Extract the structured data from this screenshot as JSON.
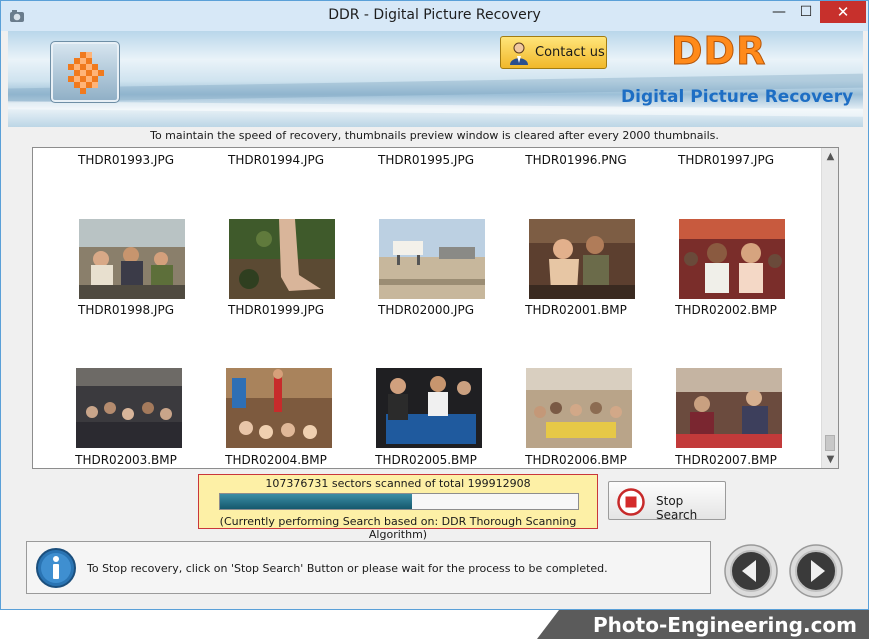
{
  "window": {
    "title": "DDR - Digital Picture Recovery",
    "min_glyph": "—",
    "max_glyph": "☐",
    "close_glyph": "✕"
  },
  "header": {
    "contact_label": "Contact us",
    "brand": "DDR",
    "subtitle": "Digital Picture Recovery"
  },
  "notice": "To maintain the speed of recovery, thumbnails preview window is cleared after every 2000 thumbnails.",
  "thumbnails": {
    "row1": [
      "THDR01993.JPG",
      "THDR01994.JPG",
      "THDR01995.JPG",
      "THDR01996.PNG",
      "THDR01997.JPG"
    ],
    "row2": [
      "THDR01998.JPG",
      "THDR01999.JPG",
      "THDR02000.JPG",
      "THDR02001.BMP",
      "THDR02002.BMP"
    ],
    "row3": [
      "THDR02003.BMP",
      "THDR02004.BMP",
      "THDR02005.BMP",
      "THDR02006.BMP",
      "THDR02007.BMP"
    ]
  },
  "progress": {
    "scanned_text": "107376731 sectors scanned of total 199912908",
    "sectors_scanned": 107376731,
    "sectors_total": 199912908,
    "fraction": 0.537,
    "algorithm_text": "(Currently performing Search based on:  DDR Thorough Scanning Algorithm)"
  },
  "stop_button": {
    "label": "Stop Search"
  },
  "status": {
    "message": "To Stop recovery, click on 'Stop Search' Button or please wait for the process to be completed."
  },
  "watermark": "Photo-Engineering.com",
  "colors": {
    "accent": "#1d6ec4",
    "brand": "#ff8a1a",
    "progress": "#1f6c82",
    "close": "#c7302c"
  },
  "icons": [
    "app-icon",
    "logo-checker-icon",
    "person-icon",
    "stop-icon",
    "info-icon",
    "back-arrow-icon",
    "next-arrow-icon",
    "scroll-up-icon",
    "scroll-down-icon"
  ]
}
